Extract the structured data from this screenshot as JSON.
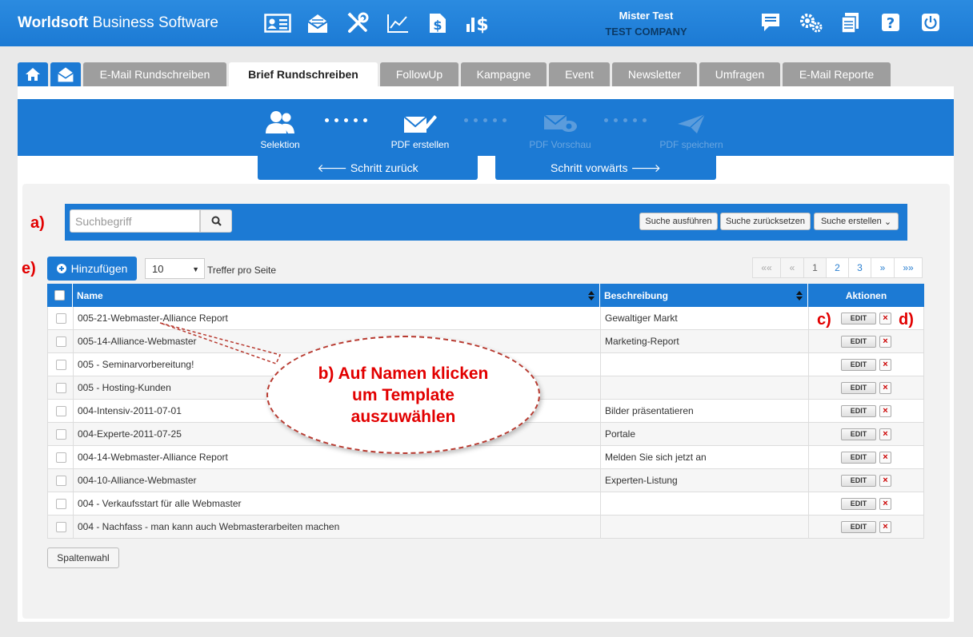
{
  "app": {
    "brand_bold": "Worldsoft",
    "brand_rest": " Business Software"
  },
  "header": {
    "top_icons": [
      "id-card-icon",
      "mail-open-icon",
      "tools-icon",
      "chart-line-icon",
      "document-dollar-icon",
      "bar-dollar-icon"
    ],
    "user_name": "Mister Test",
    "company": "TEST COMPANY",
    "right_icons": [
      "chat-icon",
      "gears-icon",
      "documents-icon",
      "help-icon",
      "power-icon"
    ]
  },
  "tabs": [
    {
      "label": "E-Mail Rundschreiben",
      "active": false
    },
    {
      "label": "Brief Rundschreiben",
      "active": true
    },
    {
      "label": "FollowUp",
      "active": false
    },
    {
      "label": "Kampagne",
      "active": false
    },
    {
      "label": "Event",
      "active": false
    },
    {
      "label": "Newsletter",
      "active": false
    },
    {
      "label": "Umfragen",
      "active": false
    },
    {
      "label": "E-Mail Reporte",
      "active": false
    }
  ],
  "wizard": {
    "steps": [
      {
        "label": "Selektion",
        "icon": "users-icon",
        "enabled": true
      },
      {
        "label": "PDF erstellen",
        "icon": "mail-edit-icon",
        "enabled": true
      },
      {
        "label": "PDF Vorschau",
        "icon": "mail-eye-icon",
        "enabled": false
      },
      {
        "label": "PDF speichern",
        "icon": "paper-plane-icon",
        "enabled": false
      }
    ],
    "back_label": "Schritt zurück",
    "forward_label": "Schritt vorwärts"
  },
  "search": {
    "placeholder": "Suchbegriff",
    "execute_label": "Suche ausführen",
    "reset_label": "Suche zurücksetzen",
    "create_label": "Suche erstellen"
  },
  "list": {
    "add_label": "Hinzufügen",
    "per_page": "10",
    "per_page_label": "Treffer pro Seite",
    "pager": [
      "««",
      "«",
      "1",
      "2",
      "3",
      "»",
      "»»"
    ],
    "columns": {
      "name": "Name",
      "description": "Beschreibung",
      "actions": "Aktionen"
    },
    "edit_label": "EDIT",
    "delete_label": "×",
    "rows": [
      {
        "name": "005-21-Webmaster-Alliance Report",
        "description": "Gewaltiger Markt"
      },
      {
        "name": "005-14-Alliance-Webmaster",
        "description": "Marketing-Report"
      },
      {
        "name": "005 - Seminarvorbereitung!",
        "description": ""
      },
      {
        "name": "005 - Hosting-Kunden",
        "description": ""
      },
      {
        "name": "004-Intensiv-2011-07-01",
        "description": "Bilder präsentatieren"
      },
      {
        "name": "004-Experte-2011-07-25",
        "description": "Portale"
      },
      {
        "name": "004-14-Webmaster-Alliance Report",
        "description": "Melden Sie sich jetzt an"
      },
      {
        "name": "004-10-Alliance-Webmaster",
        "description": "Experten-Listung"
      },
      {
        "name": "004 - Verkaufsstart für alle Webmaster",
        "description": ""
      },
      {
        "name": "004 - Nachfass - man kann auch Webmasterarbeiten machen",
        "description": ""
      }
    ],
    "column_choice_label": "Spaltenwahl"
  },
  "annotations": {
    "a": "a)",
    "b": "b) Auf Namen klicken\num Template\nauszuwählen",
    "c": "c)",
    "d": "d)",
    "e": "e)"
  }
}
